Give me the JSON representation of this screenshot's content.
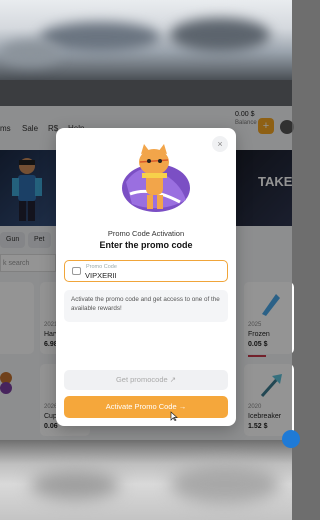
{
  "nav": {
    "items": [
      "ms",
      "Sale",
      "R$",
      "Help"
    ],
    "balance_amount": "0.00 $",
    "balance_label": "Balance",
    "add_symbol": "+"
  },
  "banner": {
    "right_text": "TAKE"
  },
  "filters": {
    "chips": [
      "Gun",
      "Pet"
    ],
    "search_placeholder": "k search"
  },
  "cards": [
    {
      "year": "",
      "name": "er",
      "price": ""
    },
    {
      "year": "2021",
      "name": "Harv",
      "price": "6.98"
    },
    {
      "year": "2025",
      "name": "Frozen",
      "price": "0.05 $"
    },
    {
      "year": "2026",
      "name": "Cupi",
      "price": "0.06"
    },
    {
      "year": "2020",
      "name": "Icebreaker",
      "price": "1.52 $"
    }
  ],
  "modal": {
    "close_symbol": "×",
    "subtitle": "Promo Code Activation",
    "title": "Enter the promo code",
    "field_label": "Promo Code",
    "field_value": "VIPXERII",
    "info_text": "Activate the promo code and get access to one of the available rewards!",
    "get_button": "Get promocode ↗",
    "activate_button": "Activate Promo Code →"
  },
  "colors": {
    "accent": "#f5a73b",
    "field_border": "#f0a53a"
  }
}
